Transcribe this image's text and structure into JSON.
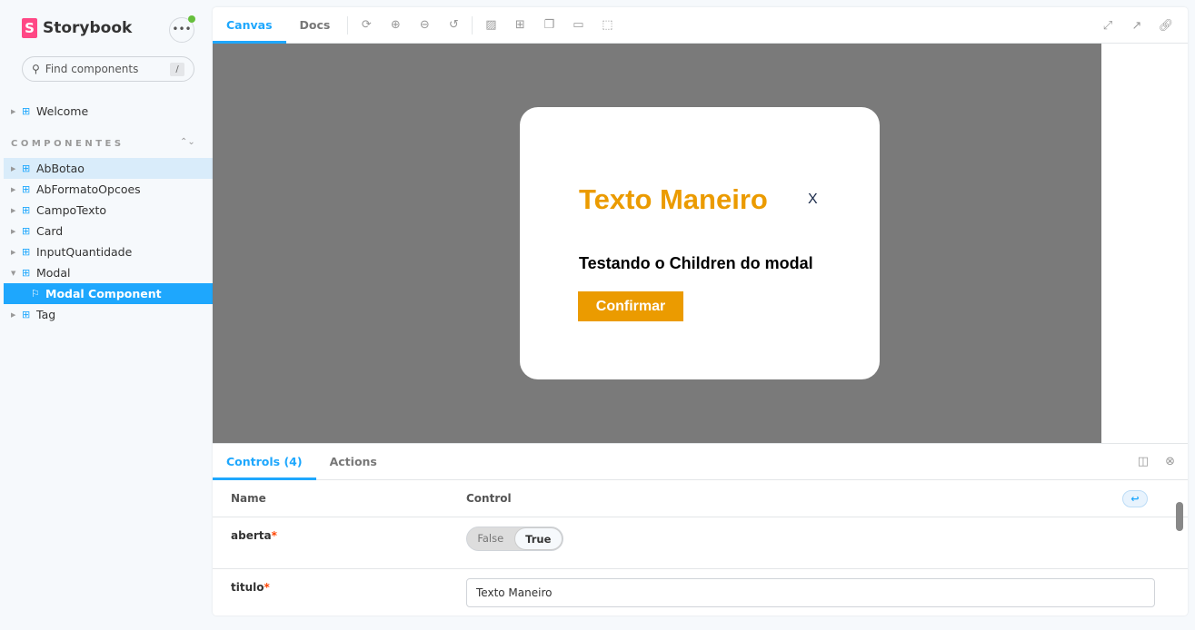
{
  "app": {
    "name": "Storybook",
    "logo_letter": "S",
    "menu_icon": "ellipsis-icon"
  },
  "search": {
    "placeholder": "Find components",
    "shortcut": "/"
  },
  "sidebar": {
    "top_items": [
      {
        "label": "Welcome"
      }
    ],
    "group": "COMPONENTES",
    "items": [
      {
        "label": "AbBotao"
      },
      {
        "label": "AbFormatoOpcoes"
      },
      {
        "label": "CampoTexto"
      },
      {
        "label": "Card"
      },
      {
        "label": "InputQuantidade"
      },
      {
        "label": "Modal",
        "expanded": true
      },
      {
        "label": "Modal Component",
        "selected": true
      },
      {
        "label": "Tag"
      }
    ]
  },
  "toolbar": {
    "tabs": [
      {
        "label": "Canvas",
        "active": true
      },
      {
        "label": "Docs"
      }
    ]
  },
  "modal": {
    "title": "Texto Maneiro",
    "close": "X",
    "body": "Testando o Children do modal",
    "button": "Confirmar"
  },
  "colors": {
    "accent": "#1ea7fd",
    "brand": "#ff4785",
    "modal_accent": "#eb9b00"
  },
  "panel": {
    "tabs": [
      {
        "label": "Controls (4)",
        "active": true
      },
      {
        "label": "Actions"
      }
    ],
    "headers": {
      "name": "Name",
      "control": "Control"
    },
    "rows": [
      {
        "name": "aberta",
        "required": "*",
        "options": [
          "False",
          "True"
        ],
        "value": "True"
      },
      {
        "name": "titulo",
        "required": "*",
        "value": "Texto Maneiro"
      }
    ]
  }
}
